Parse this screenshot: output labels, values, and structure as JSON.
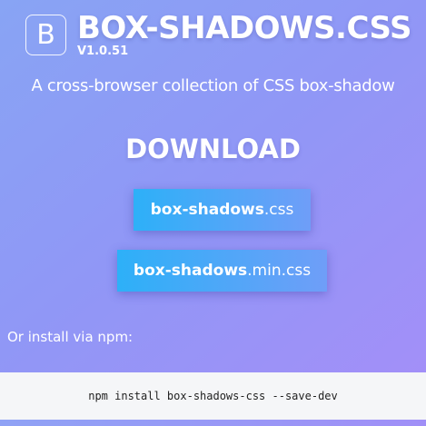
{
  "header": {
    "logo_letter": "B",
    "title": "BOX-SHADOWS.CSS",
    "version": "V1.0.51",
    "tagline": "A cross-browser collection of CSS box-shadow"
  },
  "download": {
    "heading": "DOWNLOAD",
    "buttons": [
      {
        "name_bold": "box-shadows",
        "extension": ".css"
      },
      {
        "name_bold": "box-shadows",
        "extension": ".min.css"
      }
    ]
  },
  "npm": {
    "label": "Or install via npm:",
    "command": "npm install box-shadows-css --save-dev"
  },
  "colors": {
    "background_start": "#88a4f4",
    "background_end": "#a58ef8",
    "button_start": "#2db0f8",
    "button_end": "#6f9ef8",
    "code_background": "#f5f6f8"
  }
}
